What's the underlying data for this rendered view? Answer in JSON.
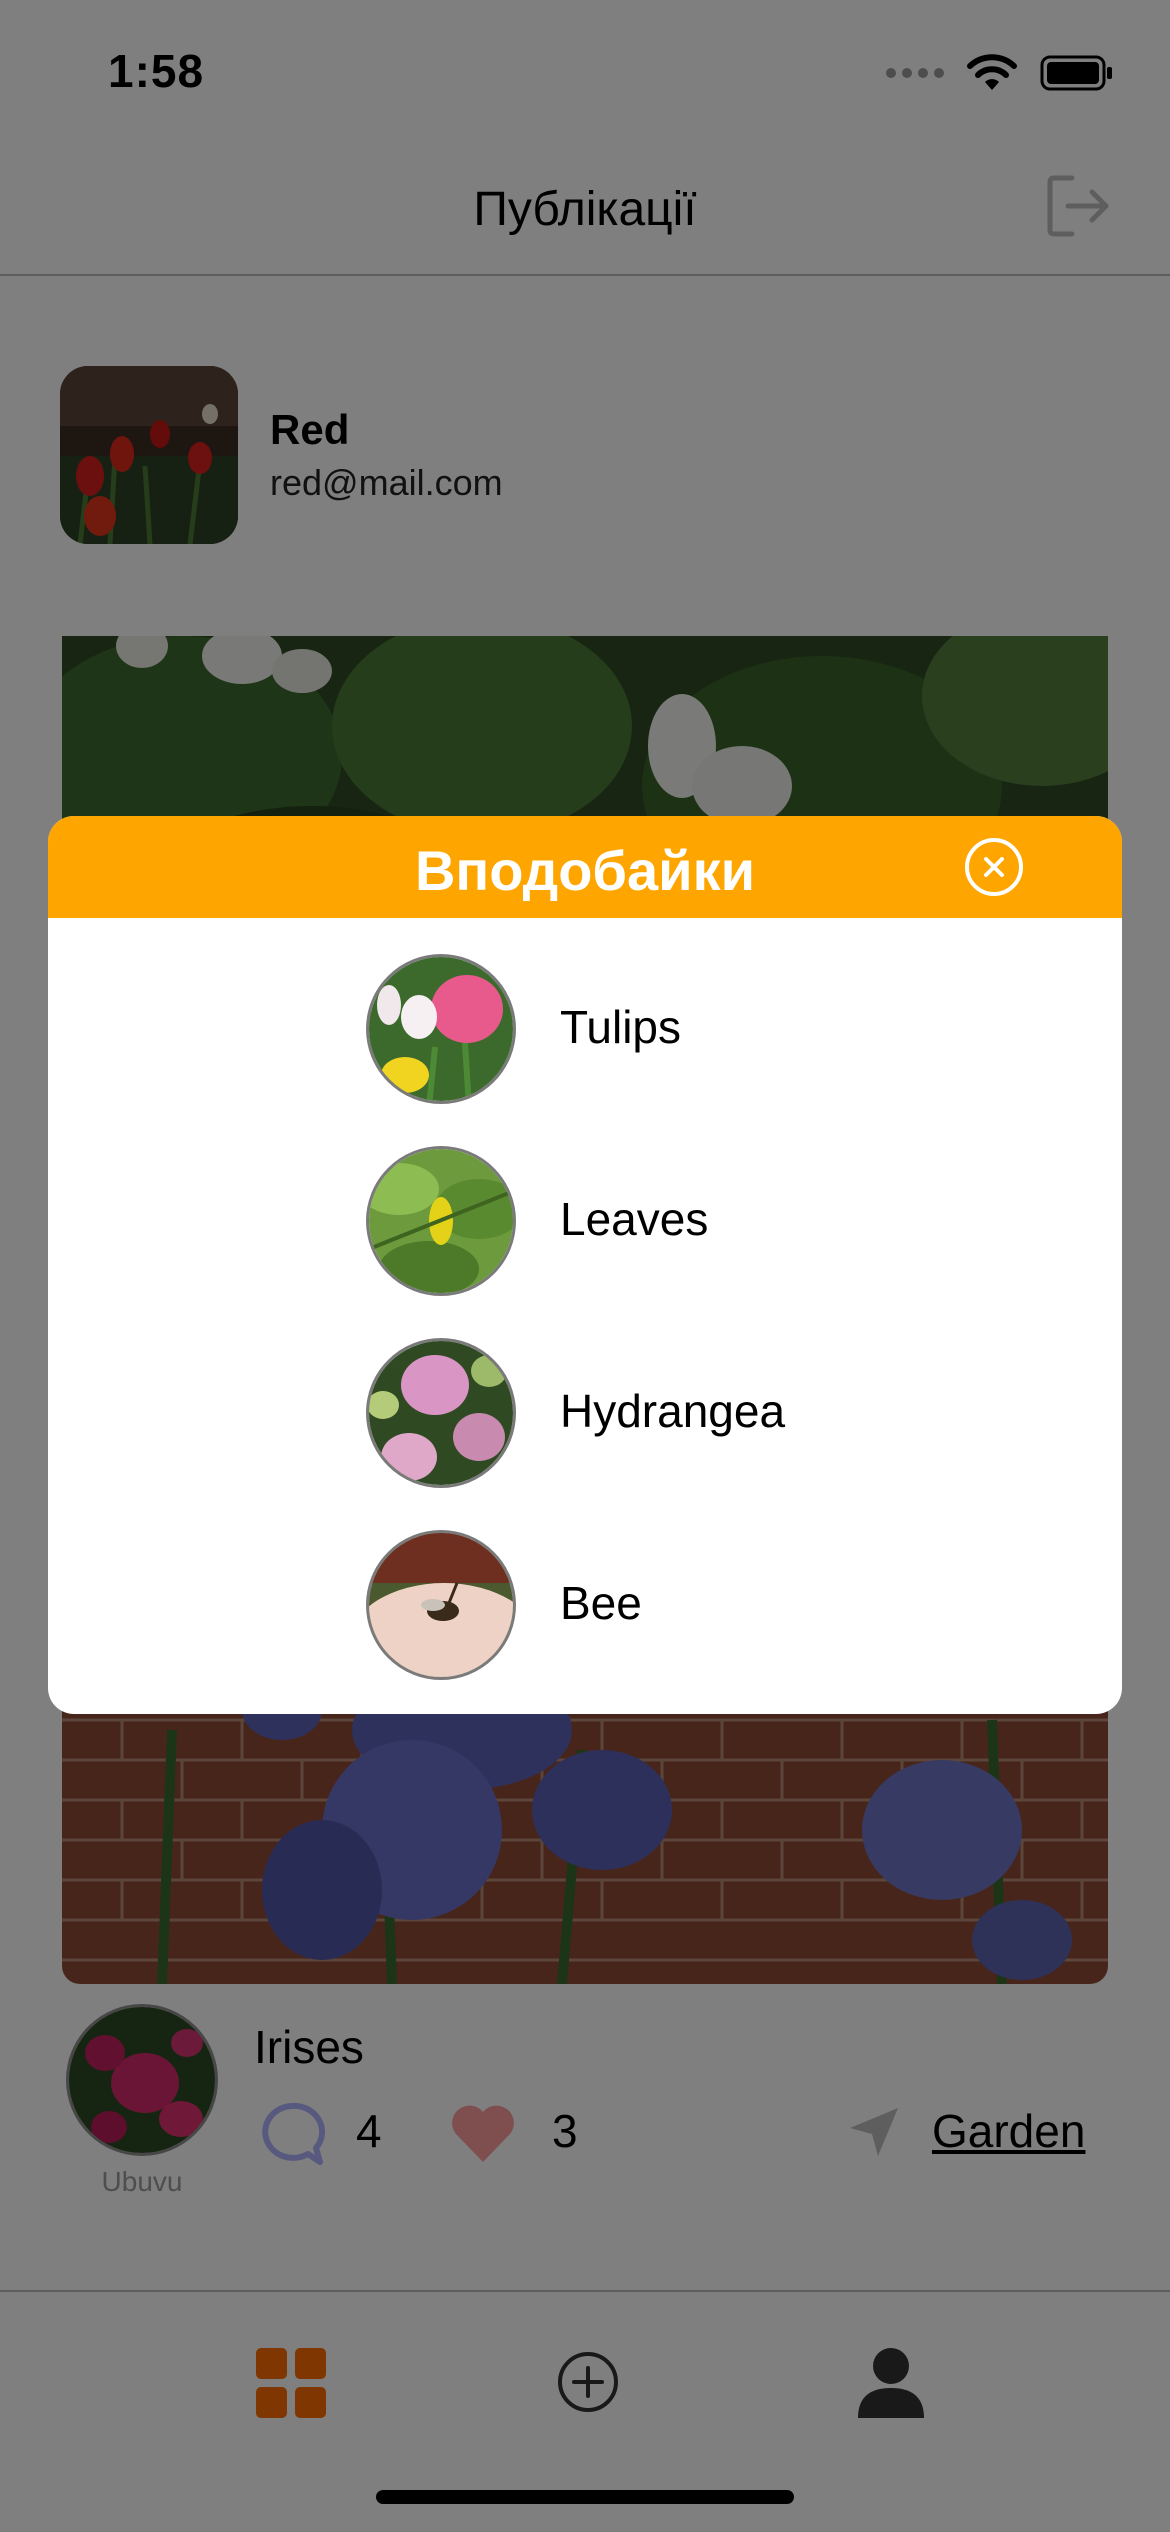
{
  "status_bar": {
    "time": "1:58"
  },
  "header": {
    "title": "Публікації"
  },
  "profile": {
    "name": "Red",
    "email": "red@mail.com"
  },
  "post": {
    "title": "Irises",
    "author": "Ubuvu",
    "comments": "4",
    "likes": "3",
    "location": "Garden"
  },
  "likes_modal": {
    "title": "Вподобайки",
    "users": [
      {
        "name": "Tulips"
      },
      {
        "name": "Leaves"
      },
      {
        "name": "Hydrangea"
      },
      {
        "name": "Bee"
      }
    ]
  },
  "colors": {
    "accent": "#FFA500",
    "active_tab": "#FF6C00"
  },
  "icons": [
    "logout-icon",
    "close-icon",
    "comment-icon",
    "heart-icon",
    "location-icon",
    "grid-icon",
    "add-icon",
    "user-icon",
    "wifi-icon",
    "battery-icon"
  ]
}
